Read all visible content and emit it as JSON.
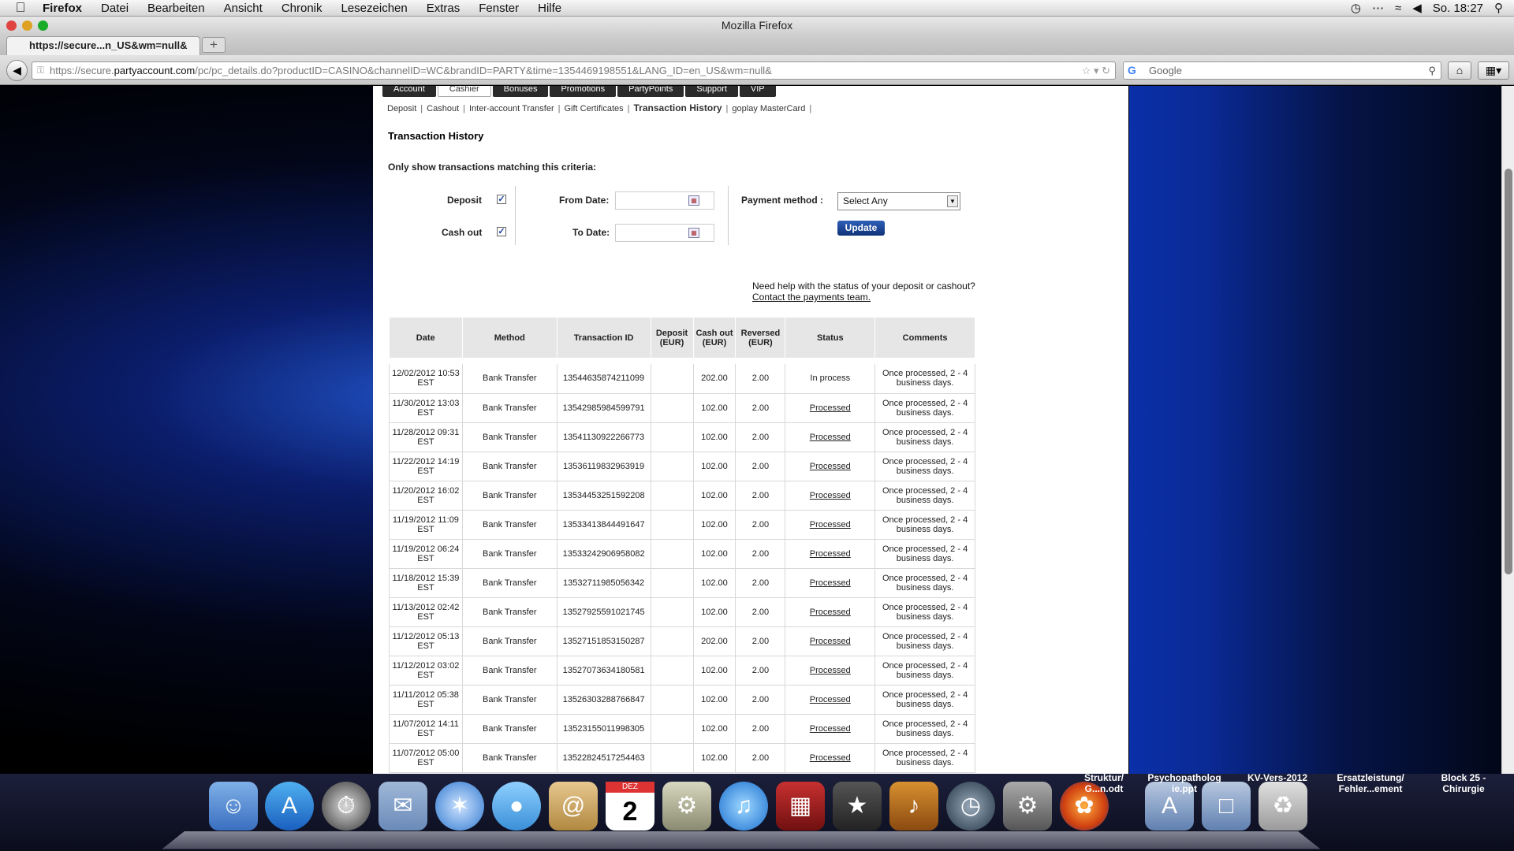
{
  "menubar": {
    "items": [
      "Firefox",
      "Datei",
      "Bearbeiten",
      "Ansicht",
      "Chronik",
      "Lesezeichen",
      "Extras",
      "Fenster",
      "Hilfe"
    ],
    "clock": "So. 18:27"
  },
  "window": {
    "title": "Mozilla Firefox"
  },
  "tab": {
    "label": "https://secure...n_US&wm=null&"
  },
  "url": {
    "prefix": "https://secure.",
    "domain": "partyaccount.com",
    "path": "/pc/pc_details.do?productID=CASINO&channelID=WC&brandID=PARTY&time=1354469198551&LANG_ID=en_US&wm=null&"
  },
  "search": {
    "placeholder": "Google"
  },
  "page": {
    "main_tabs": [
      "Account",
      "Cashier",
      "Bonuses",
      "Promotions",
      "PartyPoints",
      "Support",
      "VIP"
    ],
    "active_tab": "Cashier",
    "subnav": [
      "Deposit",
      "Cashout",
      "Inter-account Transfer",
      "Gift Certificates",
      "Transaction History",
      "goplay MasterCard"
    ],
    "title": "Transaction History",
    "criteria_label": "Only show transactions matching this criteria:",
    "deposit_label": "Deposit",
    "cashout_label": "Cash out",
    "from_label": "From Date:",
    "to_label": "To Date:",
    "payment_label": "Payment method :",
    "payment_value": "Select Any",
    "update_label": "Update",
    "help_text": "Need help with the status of your deposit or cashout?",
    "help_link": "Contact the payments team."
  },
  "table": {
    "headers": [
      "Date",
      "Method",
      "Transaction ID",
      "Deposit (EUR)",
      "Cash out (EUR)",
      "Reversed (EUR)",
      "Status",
      "Comments"
    ],
    "rows": [
      [
        "12/02/2012 10:53 EST",
        "Bank Transfer",
        "13544635874211099",
        "",
        "202.00",
        "2.00",
        "In process",
        "Once processed, 2 - 4 business days."
      ],
      [
        "11/30/2012 13:03 EST",
        "Bank Transfer",
        "13542985984599791",
        "",
        "102.00",
        "2.00",
        "Processed",
        "Once processed, 2 - 4 business days."
      ],
      [
        "11/28/2012 09:31 EST",
        "Bank Transfer",
        "13541130922266773",
        "",
        "102.00",
        "2.00",
        "Processed",
        "Once processed, 2 - 4 business days."
      ],
      [
        "11/22/2012 14:19 EST",
        "Bank Transfer",
        "13536119832963919",
        "",
        "102.00",
        "2.00",
        "Processed",
        "Once processed, 2 - 4 business days."
      ],
      [
        "11/20/2012 16:02 EST",
        "Bank Transfer",
        "13534453251592208",
        "",
        "102.00",
        "2.00",
        "Processed",
        "Once processed, 2 - 4 business days."
      ],
      [
        "11/19/2012 11:09 EST",
        "Bank Transfer",
        "13533413844491647",
        "",
        "102.00",
        "2.00",
        "Processed",
        "Once processed, 2 - 4 business days."
      ],
      [
        "11/19/2012 06:24 EST",
        "Bank Transfer",
        "13533242906958082",
        "",
        "102.00",
        "2.00",
        "Processed",
        "Once processed, 2 - 4 business days."
      ],
      [
        "11/18/2012 15:39 EST",
        "Bank Transfer",
        "13532711985056342",
        "",
        "102.00",
        "2.00",
        "Processed",
        "Once processed, 2 - 4 business days."
      ],
      [
        "11/13/2012 02:42 EST",
        "Bank Transfer",
        "13527925591021745",
        "",
        "102.00",
        "2.00",
        "Processed",
        "Once processed, 2 - 4 business days."
      ],
      [
        "11/12/2012 05:13 EST",
        "Bank Transfer",
        "13527151853150287",
        "",
        "202.00",
        "2.00",
        "Processed",
        "Once processed, 2 - 4 business days."
      ],
      [
        "11/12/2012 03:02 EST",
        "Bank Transfer",
        "13527073634180581",
        "",
        "102.00",
        "2.00",
        "Processed",
        "Once processed, 2 - 4 business days."
      ],
      [
        "11/11/2012 05:38 EST",
        "Bank Transfer",
        "13526303288766847",
        "",
        "102.00",
        "2.00",
        "Processed",
        "Once processed, 2 - 4 business days."
      ],
      [
        "11/07/2012 14:11 EST",
        "Bank Transfer",
        "13523155011998305",
        "",
        "102.00",
        "2.00",
        "Processed",
        "Once processed, 2 - 4 business days."
      ],
      [
        "11/07/2012 05:00 EST",
        "Bank Transfer",
        "13522824517254463",
        "",
        "102.00",
        "2.00",
        "Processed",
        "Once processed, 2 - 4 business days."
      ]
    ]
  },
  "dock": {
    "labels": [
      "Struktur/ G...n.odt",
      "Psychopatholog ie.ppt",
      "KV-Vers-2012",
      "Ersatzleistung/ Fehler...ement",
      "Block 25 - Chirurgie"
    ],
    "calendar_month": "DEZ",
    "calendar_day": "2"
  }
}
